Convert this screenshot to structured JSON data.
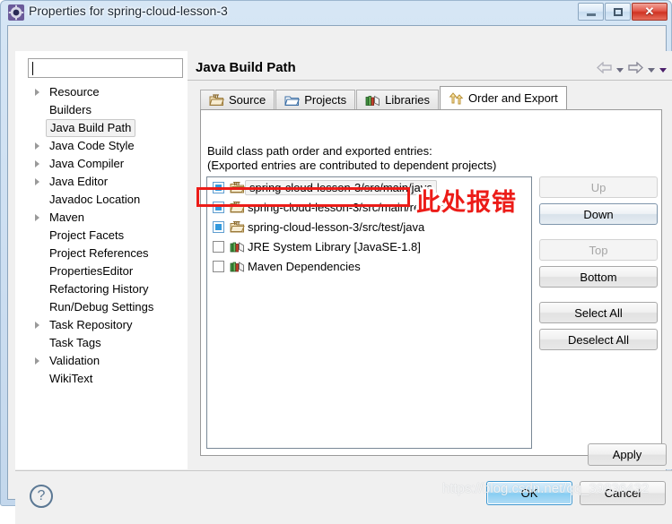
{
  "window": {
    "title": "Properties for spring-cloud-lesson-3",
    "icon": "eclipse-properties-icon",
    "controls": {
      "minimize": "Minimize",
      "maximize": "Maximize",
      "close": "Close",
      "close_glyph": "✕"
    }
  },
  "sidebar": {
    "filter": {
      "value": "",
      "placeholder": ""
    },
    "items": [
      {
        "label": "Resource",
        "expandable": true,
        "selected": false
      },
      {
        "label": "Builders",
        "expandable": false,
        "selected": false
      },
      {
        "label": "Java Build Path",
        "expandable": false,
        "selected": true
      },
      {
        "label": "Java Code Style",
        "expandable": true,
        "selected": false
      },
      {
        "label": "Java Compiler",
        "expandable": true,
        "selected": false
      },
      {
        "label": "Java Editor",
        "expandable": true,
        "selected": false
      },
      {
        "label": "Javadoc Location",
        "expandable": false,
        "selected": false
      },
      {
        "label": "Maven",
        "expandable": true,
        "selected": false
      },
      {
        "label": "Project Facets",
        "expandable": false,
        "selected": false
      },
      {
        "label": "Project References",
        "expandable": false,
        "selected": false
      },
      {
        "label": "PropertiesEditor",
        "expandable": false,
        "selected": false
      },
      {
        "label": "Refactoring History",
        "expandable": false,
        "selected": false
      },
      {
        "label": "Run/Debug Settings",
        "expandable": false,
        "selected": false
      },
      {
        "label": "Task Repository",
        "expandable": true,
        "selected": false
      },
      {
        "label": "Task Tags",
        "expandable": false,
        "selected": false
      },
      {
        "label": "Validation",
        "expandable": true,
        "selected": false
      },
      {
        "label": "WikiText",
        "expandable": false,
        "selected": false
      }
    ]
  },
  "main": {
    "page_title": "Java Build Path",
    "nav": {
      "back_icon": "back-arrow-icon",
      "back_caret_icon": "chevron-down-icon",
      "forward_icon": "forward-arrow-icon",
      "forward_caret_icon": "chevron-down-icon",
      "menu_caret_icon": "chevron-down-icon"
    },
    "tabs": [
      {
        "label": "Source",
        "icon": "source-folder-icon",
        "active": false
      },
      {
        "label": "Projects",
        "icon": "projects-folder-icon",
        "active": false
      },
      {
        "label": "Libraries",
        "icon": "libraries-books-icon",
        "active": false
      },
      {
        "label": "Order and Export",
        "icon": "order-export-arrows-icon",
        "active": true
      }
    ],
    "description_line1": "Build class path order and exported entries:",
    "description_line2": "(Exported entries are contributed to dependent projects)",
    "entries": [
      {
        "label": "spring-cloud-lesson-3/src/main/java",
        "checked": true,
        "icon": "source-folder-icon",
        "focused": true
      },
      {
        "label": "spring-cloud-lesson-3/src/main/resources",
        "checked": true,
        "icon": "source-folder-icon",
        "focused": false
      },
      {
        "label": "spring-cloud-lesson-3/src/test/java",
        "checked": true,
        "icon": "source-folder-icon",
        "focused": false
      },
      {
        "label": "JRE System Library [JavaSE-1.8]",
        "checked": false,
        "icon": "library-books-icon",
        "focused": false
      },
      {
        "label": "Maven Dependencies",
        "checked": false,
        "icon": "library-books-icon",
        "focused": false
      }
    ],
    "side_buttons": [
      {
        "label": "Up",
        "enabled": false,
        "emphasis": false
      },
      {
        "label": "Down",
        "enabled": true,
        "emphasis": true
      },
      {
        "label": "Top",
        "enabled": false,
        "emphasis": false
      },
      {
        "label": "Bottom",
        "enabled": true,
        "emphasis": false
      },
      {
        "label": "Select All",
        "enabled": true,
        "emphasis": false
      },
      {
        "label": "Deselect All",
        "enabled": true,
        "emphasis": false
      }
    ],
    "apply_label": "Apply"
  },
  "footer": {
    "help_icon": "help-question-icon",
    "help_glyph": "?",
    "ok_label": "OK",
    "cancel_label": "Cancel"
  },
  "annotations": {
    "highlight_note": "此处报错",
    "highlight_color": "#ec1c18",
    "watermark": "https://blog.csdn.net/qq_39836432"
  }
}
